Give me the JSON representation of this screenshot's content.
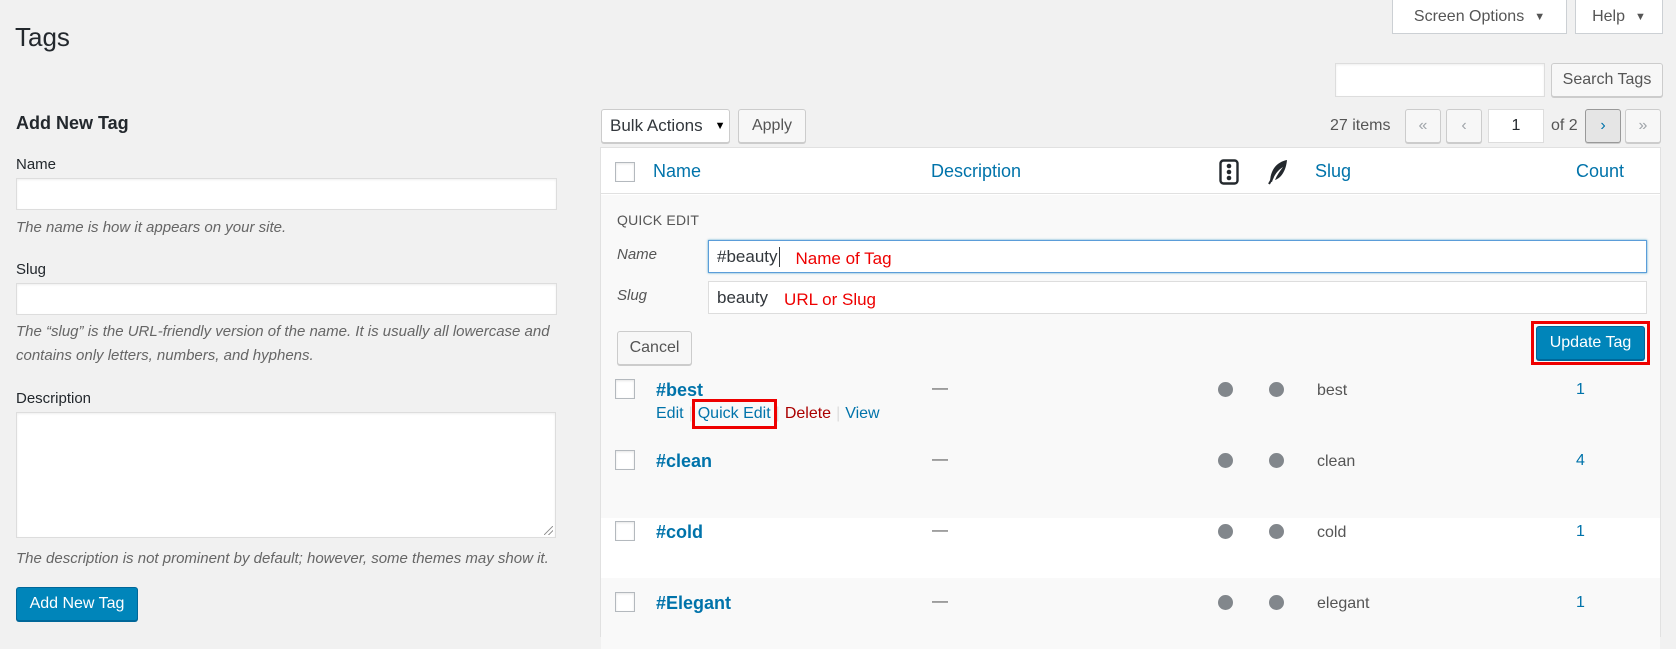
{
  "screen_meta": {
    "screen_options_label": "Screen Options",
    "help_label": "Help"
  },
  "page": {
    "title": "Tags"
  },
  "search": {
    "button_label": "Search Tags",
    "value": ""
  },
  "form": {
    "heading": "Add New Tag",
    "name_label": "Name",
    "name_help": "The name is how it appears on your site.",
    "slug_label": "Slug",
    "slug_help": "The “slug” is the URL-friendly version of the name. It is usually all lowercase and contains only letters, numbers, and hyphens.",
    "description_label": "Description",
    "description_help": "The description is not prominent by default; however, some themes may show it.",
    "submit_label": "Add New Tag"
  },
  "tablenav": {
    "bulk_actions": "Bulk Actions",
    "apply_label": "Apply",
    "items_count": "27 items",
    "first": "«",
    "prev": "‹",
    "current_page": "1",
    "of_pages": "of 2",
    "next": "›",
    "last": "»"
  },
  "columns": {
    "name": "Name",
    "description": "Description",
    "posts_icon": "comments-icon",
    "feather_icon": "feather-icon",
    "slug": "Slug",
    "count": "Count"
  },
  "quick_edit": {
    "title": "QUICK EDIT",
    "name_label": "Name",
    "name_value": "#beauty",
    "name_annotation": "Name of Tag",
    "slug_label": "Slug",
    "slug_value": "beauty",
    "slug_annotation": "URL or Slug",
    "cancel_label": "Cancel",
    "update_label": "Update Tag"
  },
  "row_actions": {
    "edit": "Edit",
    "quick_edit": "Quick Edit",
    "delete": "Delete",
    "view": "View",
    "separator": "|"
  },
  "rows": [
    {
      "name": "#best",
      "description": "—",
      "slug": "best",
      "count": "1"
    },
    {
      "name": "#clean",
      "description": "—",
      "slug": "clean",
      "count": "4"
    },
    {
      "name": "#cold",
      "description": "—",
      "slug": "cold",
      "count": "1"
    },
    {
      "name": "#Elegant",
      "description": "—",
      "slug": "elegant",
      "count": "1"
    }
  ],
  "colors": {
    "link": "#0073aa",
    "primary": "#0085ba",
    "annotation": "#ee0000",
    "delete": "#aa0000"
  }
}
